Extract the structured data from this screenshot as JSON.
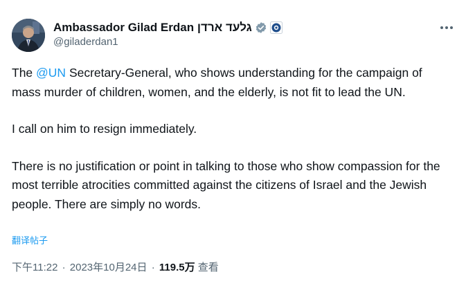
{
  "author": {
    "display_name": "Ambassador Gilad Erdan גלעד ארדן",
    "handle": "@giladerdan1",
    "verified_badge_icon": "verified-gray-check-icon",
    "affiliation_badge_icon": "government-emblem-icon"
  },
  "tweet": {
    "para1_before": "The ",
    "para1_mention": "@UN",
    "para1_after": " Secretary-General, who shows understanding for the campaign of mass murder of children, women, and the elderly, is not fit to lead the UN.",
    "para2": "I call on him to resign immediately.",
    "para3": "There is no justification or point in talking to those who show compassion for the most terrible atrocities committed against the citizens of Israel and the Jewish people. There are simply no words.",
    "translate_label": "翻译帖子"
  },
  "meta": {
    "time": "下午11:22",
    "separator": "·",
    "date": "2023年10月24日",
    "views_count": "119.5万",
    "views_label": "查看"
  },
  "colors": {
    "link": "#1d9bf0",
    "secondary_text": "#536471",
    "primary_text": "#0f1419"
  }
}
